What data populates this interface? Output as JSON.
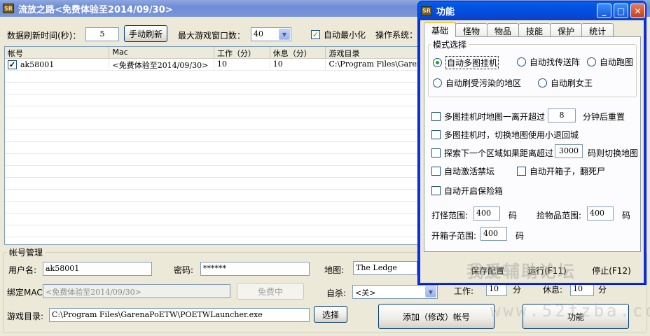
{
  "main": {
    "title": "流放之路<免费体验至2014/09/30>",
    "icon_text": "SR",
    "refresh_label": "数据刷新时间(秒)：",
    "refresh_value": "5",
    "manual_refresh": "手动刷新",
    "max_windows_label": "最大游戏窗口数：",
    "max_windows_value": "40",
    "auto_minimize": "自动最小化",
    "os_label": "操作系统："
  },
  "grid": {
    "headers": [
      "帐号",
      "Mac",
      "工作（分）",
      "休息（分）",
      "游戏目录"
    ],
    "rows": [
      {
        "account": "ak58001",
        "mac": "<免费体验至2014/09/30>",
        "work": "10",
        "rest": "10",
        "dir": "C:\\Program Files\\GarenaPo"
      }
    ]
  },
  "account": {
    "group_label": "帐号管理",
    "username_label": "用户名:",
    "username_value": "ak58001",
    "password_label": "密码:",
    "password_value": "******",
    "map_label": "地图:",
    "map_value": "The Ledge",
    "bind_mac_label": "绑定MAC",
    "bind_mac_value": "<免费体验至2014/09/30>",
    "free_button": "免费中",
    "suicide_label": "自杀:",
    "suicide_value": "<关>",
    "work_label": "工作:",
    "work_value": "10",
    "work_unit": "分",
    "rest_label": "休息:",
    "rest_value": "10",
    "rest_unit": "分",
    "game_dir_label": "游戏目录:",
    "game_dir_value": "C:\\Program Files\\GarenaPoETW\\POETWLauncher.exe",
    "choose_button": "选择",
    "add_button": "添加（修改）帐号",
    "func_button": "功能"
  },
  "dialog": {
    "title": "功能",
    "tabs": [
      "基础",
      "怪物",
      "物品",
      "技能",
      "保护",
      "统计"
    ],
    "mode_group": "模式选择",
    "modes": [
      "自动多图挂机",
      "自动找传送阵",
      "自动跑图",
      "自动刷受污染的地区",
      "自动刷女王"
    ],
    "opt1_label": "多图挂机时地图一离开超过",
    "opt1_value": "8",
    "opt1_suffix": "分钟后重置",
    "opt2_label": "多图挂机时，切换地图使用小退回城",
    "opt3_label": "探索下一个区域如果距离超过",
    "opt3_value": "3000",
    "opt3_suffix": "码则切换地图",
    "opt4_label": "自动激活禁坛",
    "opt5_label": "自动开箱子，翻死尸",
    "opt6_label": "自动开启保险箱",
    "fight_label": "打怪范围:",
    "fight_value": "400",
    "fight_unit": "码",
    "pickup_label": "捡物品范围:",
    "pickup_value": "400",
    "pickup_unit": "码",
    "chest_label": "开箱子范围:",
    "chest_value": "400",
    "chest_unit": "码",
    "save_button": "保存配置",
    "run_button": "运行(F11)",
    "stop_button": "停止(F12)"
  },
  "watermark": {
    "text1": "我爱辅助论坛",
    "text2": "www.52fzba.com"
  }
}
